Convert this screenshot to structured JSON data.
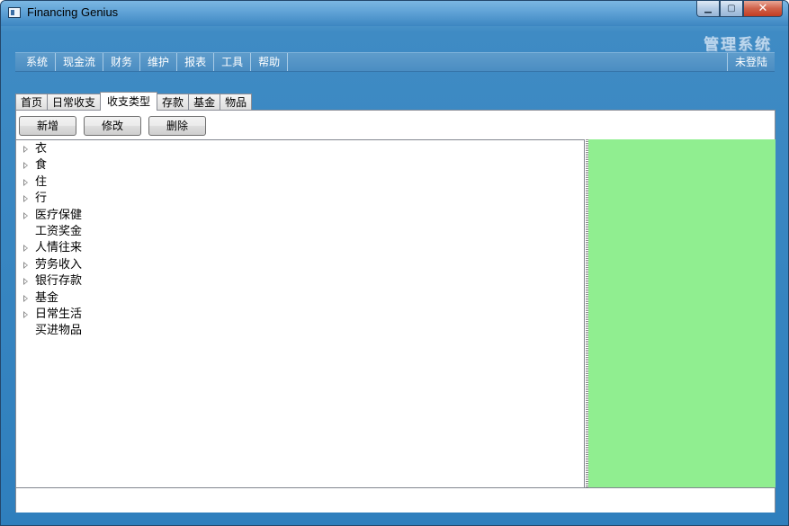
{
  "window": {
    "title": "Financing Genius",
    "caption_min": "▁",
    "caption_max": "▢",
    "caption_close": "✕"
  },
  "brand": "管理系统",
  "menu": {
    "items": [
      "系统",
      "现金流",
      "财务",
      "维护",
      "报表",
      "工具",
      "帮助"
    ],
    "login_status": "未登陆"
  },
  "tabs": {
    "items": [
      "首页",
      "日常收支",
      "收支类型",
      "存款",
      "基金",
      "物品"
    ],
    "active_index": 2
  },
  "toolbar": {
    "add_label": "新增",
    "edit_label": "修改",
    "delete_label": "删除"
  },
  "tree": {
    "items": [
      {
        "label": "衣",
        "expandable": true
      },
      {
        "label": "食",
        "expandable": true
      },
      {
        "label": "住",
        "expandable": true
      },
      {
        "label": "行",
        "expandable": true
      },
      {
        "label": "医疗保健",
        "expandable": true
      },
      {
        "label": "工资奖金",
        "expandable": false
      },
      {
        "label": "人情往来",
        "expandable": true
      },
      {
        "label": "劳务收入",
        "expandable": true
      },
      {
        "label": "银行存款",
        "expandable": true
      },
      {
        "label": "基金",
        "expandable": true
      },
      {
        "label": "日常生活",
        "expandable": true
      },
      {
        "label": "买进物品",
        "expandable": false
      }
    ]
  },
  "colors": {
    "detail_panel": "#90ee90",
    "window_frame": "#3f8bc4"
  }
}
